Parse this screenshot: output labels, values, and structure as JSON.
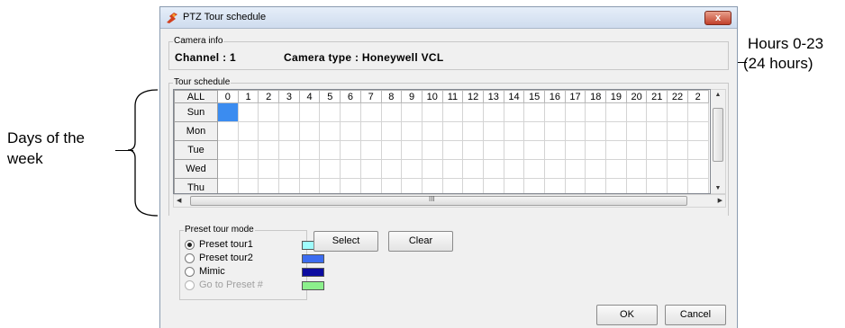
{
  "annotations": {
    "hours_line1": "Hours 0-23",
    "hours_line2": "(24 hours)",
    "days_line1": "Days of the",
    "days_line2": "week"
  },
  "window": {
    "title": "PTZ Tour schedule",
    "close_label": "x"
  },
  "camera_info": {
    "legend": "Camera info",
    "channel": "Channel : 1",
    "camera_type": "Camera type : Honeywell VCL"
  },
  "tour_schedule": {
    "legend": "Tour schedule",
    "all_label": "ALL",
    "hours": [
      "0",
      "1",
      "2",
      "3",
      "4",
      "5",
      "6",
      "7",
      "8",
      "9",
      "10",
      "11",
      "12",
      "13",
      "14",
      "15",
      "16",
      "17",
      "18",
      "19",
      "20",
      "21",
      "22",
      "2"
    ],
    "days": [
      "Sun",
      "Mon",
      "Tue",
      "Wed",
      "Thu"
    ],
    "selected": [
      {
        "day": "Sun",
        "hour": "0",
        "color": "#3b8cf0"
      }
    ],
    "hscroll_marker": "III"
  },
  "preset_mode": {
    "legend": "Preset tour mode",
    "options": [
      {
        "label": "Preset tour1",
        "color": "#9ffcfc",
        "selected": true,
        "enabled": true
      },
      {
        "label": "Preset tour2",
        "color": "#3c6cf0",
        "selected": false,
        "enabled": true
      },
      {
        "label": "Mimic",
        "color": "#0c0ca0",
        "selected": false,
        "enabled": true
      },
      {
        "label": "Go to Preset #",
        "color": "#8cf08c",
        "selected": false,
        "enabled": false
      }
    ]
  },
  "buttons": {
    "select": "Select",
    "clear": "Clear",
    "ok": "OK",
    "cancel": "Cancel"
  }
}
